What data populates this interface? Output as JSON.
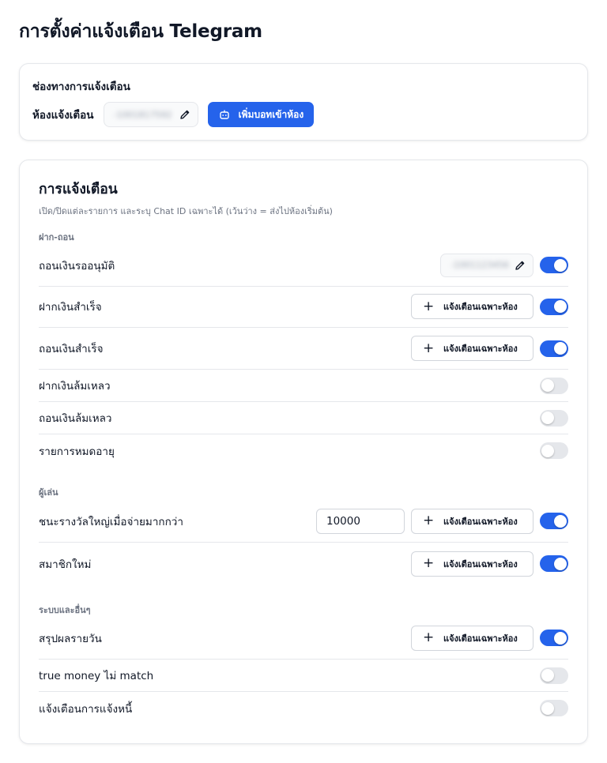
{
  "page": {
    "title": "การตั้งค่าแจ้งเตือน Telegram"
  },
  "channel": {
    "title": "ช่องทางการแจ้งเตือน",
    "room_label": "ห้องแจ้งเตือน",
    "room_value": "-1001817592",
    "add_bot_label": "เพิ่มบอทเข้าห้อง",
    "accent": "#2563eb"
  },
  "notifications": {
    "title": "การแจ้งเตือน",
    "subtitle": "เปิด/ปิดแต่ละรายการ และระบุ Chat ID เฉพาะได้ (เว้นว่าง = ส่งไปห้องเริ่มต้น)",
    "sections": [
      {
        "label": "ฝาก-ถอน",
        "items": [
          {
            "label": "ถอนเงินรออนุมัติ",
            "chat_id": "-1001123456",
            "enabled": true
          },
          {
            "label": "ฝากเงินสำเร็จ",
            "button": "แจ้งเตือนเฉพาะห้อง",
            "enabled": true
          },
          {
            "label": "ถอนเงินสำเร็จ",
            "button": "แจ้งเตือนเฉพาะห้อง",
            "enabled": true
          },
          {
            "label": "ฝากเงินล้มเหลว",
            "enabled": false
          },
          {
            "label": "ถอนเงินล้มเหลว",
            "enabled": false
          },
          {
            "label": "รายการหมดอายุ",
            "enabled": false
          }
        ]
      },
      {
        "label": "ผู้เล่น",
        "items": [
          {
            "label": "ชนะรางวัลใหญ่เมื่อจ่ายมากกว่า",
            "amount": "10000",
            "button": "แจ้งเตือนเฉพาะห้อง",
            "enabled": true
          },
          {
            "label": "สมาชิกใหม่",
            "button": "แจ้งเตือนเฉพาะห้อง",
            "enabled": true
          }
        ]
      },
      {
        "label": "ระบบและอื่นๆ",
        "items": [
          {
            "label": "สรุปผลรายวัน",
            "button": "แจ้งเตือนเฉพาะห้อง",
            "enabled": true
          },
          {
            "label": "true money ไม่ match",
            "enabled": false
          },
          {
            "label": "แจ้งเตือนการแจ้งหนี้",
            "enabled": false
          }
        ]
      }
    ]
  }
}
